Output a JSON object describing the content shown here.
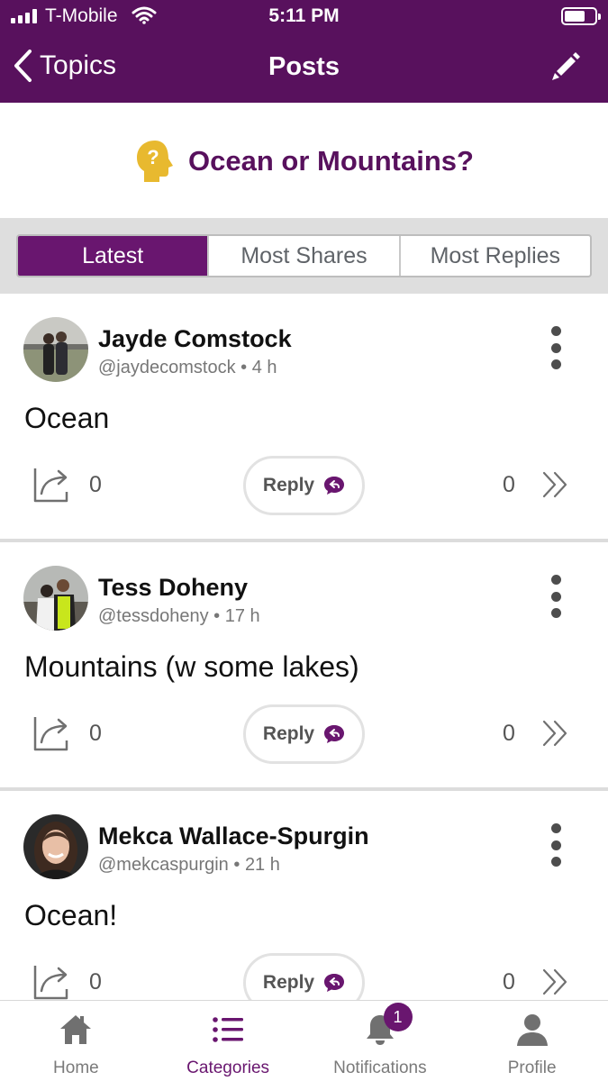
{
  "status_bar": {
    "carrier": "T-Mobile",
    "time": "5:11 PM"
  },
  "nav": {
    "back_label": "Topics",
    "title": "Posts"
  },
  "topic": {
    "title": "Ocean or Mountains?"
  },
  "tabs": [
    {
      "label": "Latest",
      "active": true
    },
    {
      "label": "Most Shares",
      "active": false
    },
    {
      "label": "Most Replies",
      "active": false
    }
  ],
  "posts": [
    {
      "author": "Jayde Comstock",
      "handle": "@jaydecomstock",
      "age": "4 h",
      "body": "Ocean",
      "shares": "0",
      "reply_label": "Reply",
      "replies": "0"
    },
    {
      "author": "Tess Doheny",
      "handle": "@tessdoheny",
      "age": "17 h",
      "body": "Mountains (w some lakes)",
      "shares": "0",
      "reply_label": "Reply",
      "replies": "0"
    },
    {
      "author": "Mekca Wallace-Spurgin",
      "handle": "@mekcaspurgin",
      "age": "21 h",
      "body": "Ocean!",
      "shares": "0",
      "reply_label": "Reply",
      "replies": "0"
    }
  ],
  "tabbar": {
    "items": [
      {
        "label": "Home",
        "icon": "home-icon"
      },
      {
        "label": "Categories",
        "icon": "list-icon",
        "active": true
      },
      {
        "label": "Notifications",
        "icon": "bell-icon",
        "badge": "1"
      },
      {
        "label": "Profile",
        "icon": "person-icon"
      }
    ]
  },
  "colors": {
    "brand": "#58115d",
    "accent": "#69166f",
    "topic_icon": "#e8b92f"
  }
}
